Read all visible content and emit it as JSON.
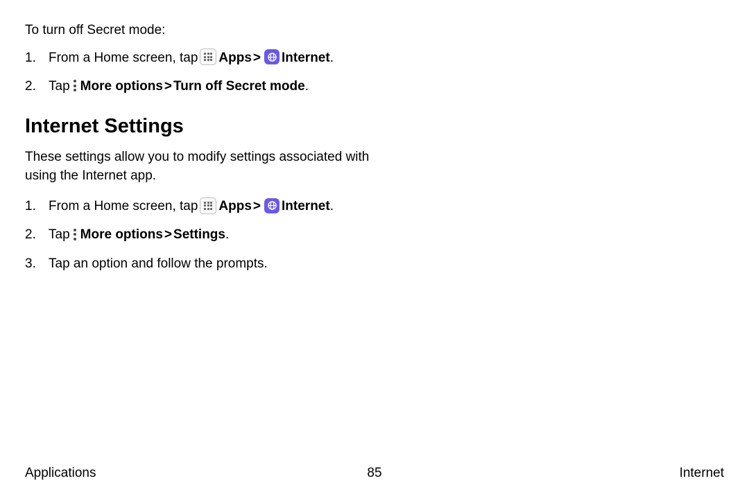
{
  "intro": "To turn off Secret mode:",
  "steps_a": {
    "1": {
      "num": "1.",
      "pre": "From a Home screen, tap ",
      "apps": "Apps",
      "chev": ">",
      "internet": "Internet",
      "end": "."
    },
    "2": {
      "num": "2.",
      "pre": "Tap ",
      "more": "More options",
      "chev": ">",
      "action": "Turn off Secret mode",
      "end": "."
    }
  },
  "section_title": "Internet Settings",
  "section_desc": "These settings allow you to modify settings associated with using the Internet app.",
  "steps_b": {
    "1": {
      "num": "1.",
      "pre": "From a Home screen, tap ",
      "apps": "Apps",
      "chev": ">",
      "internet": "Internet",
      "end": "."
    },
    "2": {
      "num": "2.",
      "pre": "Tap ",
      "more": "More options",
      "chev": ">",
      "action": "Settings",
      "end": "."
    },
    "3": {
      "num": "3.",
      "text": "Tap an option and follow the prompts."
    }
  },
  "footer": {
    "left": "Applications",
    "center": "85",
    "right": "Internet"
  }
}
